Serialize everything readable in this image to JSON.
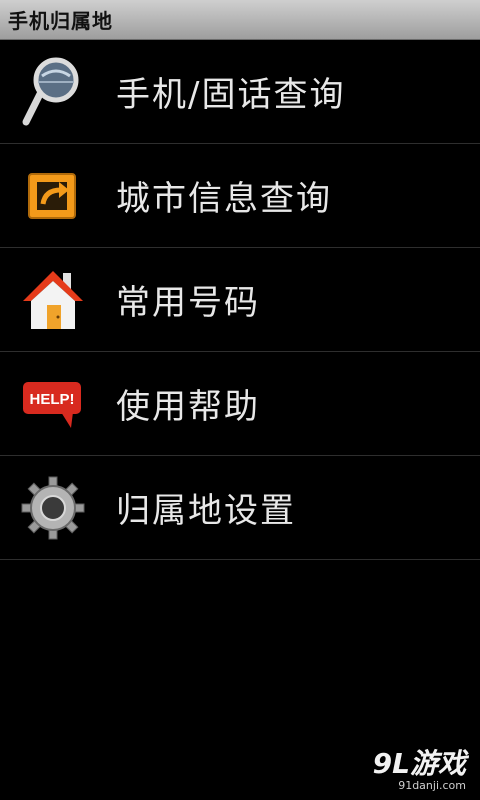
{
  "app": {
    "title": "手机归属地"
  },
  "menu": {
    "items": [
      {
        "label": "手机/固话查询",
        "icon": "magnifier-icon"
      },
      {
        "label": "城市信息查询",
        "icon": "city-info-icon"
      },
      {
        "label": "常用号码",
        "icon": "house-icon"
      },
      {
        "label": "使用帮助",
        "icon": "help-icon"
      },
      {
        "label": "归属地设置",
        "icon": "gear-icon"
      }
    ]
  },
  "watermark": {
    "main": "9L游戏",
    "sub": "91danji.com"
  },
  "colors": {
    "background": "#000000",
    "titlebar": "#b5b5b5",
    "item_text": "#e8e8e8",
    "divider": "#2e2e2e"
  }
}
